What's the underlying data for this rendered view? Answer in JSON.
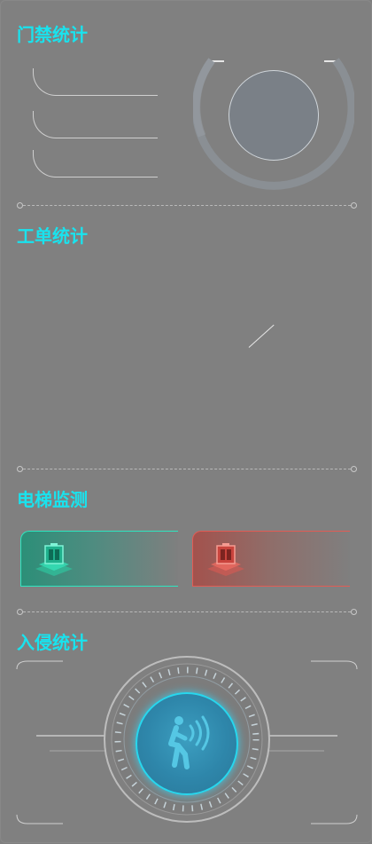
{
  "sections": {
    "access": {
      "title": "门禁统计"
    },
    "workorder": {
      "title": "工单统计"
    },
    "elevator": {
      "title": "电梯监测"
    },
    "intrusion": {
      "title": "入侵统计"
    }
  },
  "colors": {
    "title": "#19e3ee",
    "elevator_normal": "#2ee6c0",
    "elevator_fault": "#e25c55",
    "intrusion_accent": "#22c8e6"
  },
  "icons": {
    "elevator_normal": "elevator-icon",
    "elevator_fault": "elevator-icon",
    "intrusion": "walking-person-sensor-icon"
  }
}
